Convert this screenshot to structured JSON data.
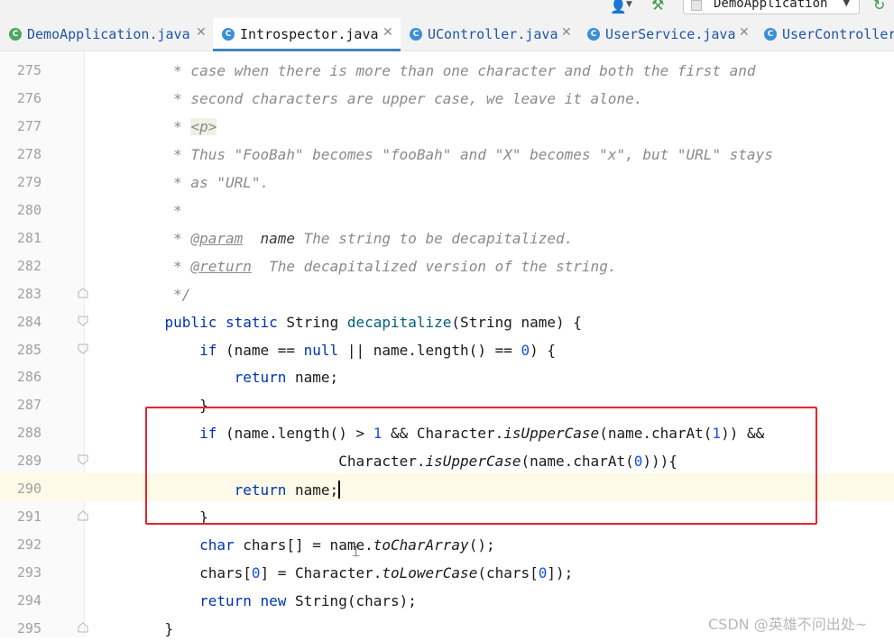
{
  "toolbar": {
    "run_config": "DemoApplication",
    "icons": [
      "user-icon",
      "hammer-icon",
      "rerun-icon"
    ]
  },
  "tabs": [
    {
      "label": "DemoApplication.java",
      "icon": "spring-class-icon",
      "active": false
    },
    {
      "label": "Introspector.java",
      "icon": "class-icon",
      "active": true
    },
    {
      "label": "UController.java",
      "icon": "class-icon",
      "active": false
    },
    {
      "label": "UserService.java",
      "icon": "class-icon",
      "active": false
    },
    {
      "label": "UserController",
      "icon": "class-icon",
      "active": false
    }
  ],
  "editor": {
    "current_line": 290,
    "lines": [
      {
        "num": "275",
        "segs": [
          [
            "cm",
            "     * case when there is more than one character and both the first and"
          ]
        ]
      },
      {
        "num": "276",
        "segs": [
          [
            "cm",
            "     * second characters are upper case, we leave it alone."
          ]
        ]
      },
      {
        "num": "277",
        "segs": [
          [
            "cm",
            "     * "
          ],
          [
            "tag",
            "<p>"
          ]
        ]
      },
      {
        "num": "278",
        "segs": [
          [
            "cm",
            "     * Thus \"FooBah\" becomes \"fooBah\" and \"X\" becomes \"x\", but \"URL\" stays"
          ]
        ]
      },
      {
        "num": "279",
        "segs": [
          [
            "cm",
            "     * as \"URL\"."
          ]
        ]
      },
      {
        "num": "280",
        "segs": [
          [
            "cm",
            "     *"
          ]
        ]
      },
      {
        "num": "281",
        "segs": [
          [
            "cm",
            "     * "
          ],
          [
            "doctag",
            "@param"
          ],
          [
            "cm",
            "  "
          ],
          [
            "param",
            "name"
          ],
          [
            "cm",
            " The string to be decapitalized."
          ]
        ]
      },
      {
        "num": "282",
        "segs": [
          [
            "cm",
            "     * "
          ],
          [
            "doctag",
            "@return"
          ],
          [
            "cm",
            "  The decapitalized version of the string."
          ]
        ]
      },
      {
        "num": "283",
        "segs": [
          [
            "cm",
            "     */"
          ]
        ]
      },
      {
        "num": "284",
        "segs": [
          [
            "pl",
            "    "
          ],
          [
            "kw",
            "public static"
          ],
          [
            "pl",
            " String "
          ],
          [
            "fn",
            "decapitalize"
          ],
          [
            "pl",
            "(String name) {"
          ]
        ]
      },
      {
        "num": "285",
        "segs": [
          [
            "pl",
            "        "
          ],
          [
            "kw",
            "if"
          ],
          [
            "pl",
            " (name == "
          ],
          [
            "kw",
            "null"
          ],
          [
            "pl",
            " || name.length() == "
          ],
          [
            "num",
            "0"
          ],
          [
            "pl",
            ") {"
          ]
        ]
      },
      {
        "num": "286",
        "segs": [
          [
            "pl",
            "            "
          ],
          [
            "kw",
            "return"
          ],
          [
            "pl",
            " name;"
          ]
        ]
      },
      {
        "num": "287",
        "segs": [
          [
            "pl",
            "        }"
          ]
        ]
      },
      {
        "num": "288",
        "segs": [
          [
            "pl",
            "        "
          ],
          [
            "kw",
            "if"
          ],
          [
            "pl",
            " (name.length() > "
          ],
          [
            "num",
            "1"
          ],
          [
            "pl",
            " && Character."
          ],
          [
            "st",
            "isUpperCase"
          ],
          [
            "pl",
            "(name.charAt("
          ],
          [
            "num",
            "1"
          ],
          [
            "pl",
            ")) &&"
          ]
        ]
      },
      {
        "num": "289",
        "segs": [
          [
            "pl",
            "                        Character."
          ],
          [
            "st",
            "isUpperCase"
          ],
          [
            "pl",
            "(name.charAt("
          ],
          [
            "num",
            "0"
          ],
          [
            "pl",
            "))){"
          ]
        ]
      },
      {
        "num": "290",
        "segs": [
          [
            "pl",
            "            "
          ],
          [
            "kw",
            "return"
          ],
          [
            "pl",
            " name;"
          ]
        ]
      },
      {
        "num": "291",
        "segs": [
          [
            "pl",
            "        }"
          ]
        ]
      },
      {
        "num": "292",
        "segs": [
          [
            "pl",
            "        "
          ],
          [
            "kw",
            "char"
          ],
          [
            "pl",
            " chars[] = name."
          ],
          [
            "st",
            "toCharArray"
          ],
          [
            "pl",
            "();"
          ]
        ]
      },
      {
        "num": "293",
        "segs": [
          [
            "pl",
            "        chars["
          ],
          [
            "num",
            "0"
          ],
          [
            "pl",
            "] = Character."
          ],
          [
            "st",
            "toLowerCase"
          ],
          [
            "pl",
            "(chars["
          ],
          [
            "num",
            "0"
          ],
          [
            "pl",
            "]);"
          ]
        ]
      },
      {
        "num": "294",
        "segs": [
          [
            "pl",
            "        "
          ],
          [
            "kw",
            "return new"
          ],
          [
            "pl",
            " String(chars);"
          ]
        ]
      },
      {
        "num": "295",
        "segs": [
          [
            "pl",
            "    }"
          ]
        ]
      }
    ]
  },
  "watermark": "CSDN @英雄不问出处~"
}
